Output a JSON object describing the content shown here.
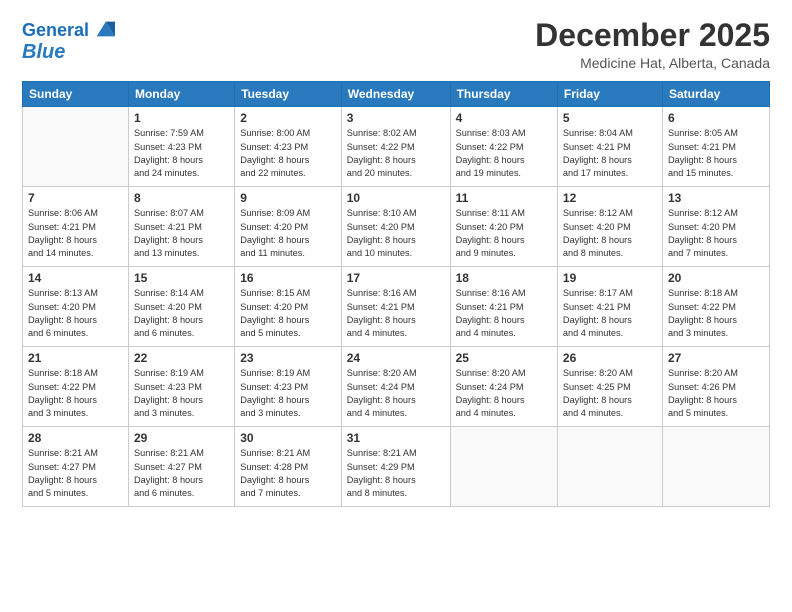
{
  "logo": {
    "line1": "General",
    "line2": "Blue"
  },
  "header": {
    "month": "December 2025",
    "location": "Medicine Hat, Alberta, Canada"
  },
  "weekdays": [
    "Sunday",
    "Monday",
    "Tuesday",
    "Wednesday",
    "Thursday",
    "Friday",
    "Saturday"
  ],
  "weeks": [
    [
      {
        "day": "",
        "info": ""
      },
      {
        "day": "1",
        "info": "Sunrise: 7:59 AM\nSunset: 4:23 PM\nDaylight: 8 hours\nand 24 minutes."
      },
      {
        "day": "2",
        "info": "Sunrise: 8:00 AM\nSunset: 4:23 PM\nDaylight: 8 hours\nand 22 minutes."
      },
      {
        "day": "3",
        "info": "Sunrise: 8:02 AM\nSunset: 4:22 PM\nDaylight: 8 hours\nand 20 minutes."
      },
      {
        "day": "4",
        "info": "Sunrise: 8:03 AM\nSunset: 4:22 PM\nDaylight: 8 hours\nand 19 minutes."
      },
      {
        "day": "5",
        "info": "Sunrise: 8:04 AM\nSunset: 4:21 PM\nDaylight: 8 hours\nand 17 minutes."
      },
      {
        "day": "6",
        "info": "Sunrise: 8:05 AM\nSunset: 4:21 PM\nDaylight: 8 hours\nand 15 minutes."
      }
    ],
    [
      {
        "day": "7",
        "info": "Sunrise: 8:06 AM\nSunset: 4:21 PM\nDaylight: 8 hours\nand 14 minutes."
      },
      {
        "day": "8",
        "info": "Sunrise: 8:07 AM\nSunset: 4:21 PM\nDaylight: 8 hours\nand 13 minutes."
      },
      {
        "day": "9",
        "info": "Sunrise: 8:09 AM\nSunset: 4:20 PM\nDaylight: 8 hours\nand 11 minutes."
      },
      {
        "day": "10",
        "info": "Sunrise: 8:10 AM\nSunset: 4:20 PM\nDaylight: 8 hours\nand 10 minutes."
      },
      {
        "day": "11",
        "info": "Sunrise: 8:11 AM\nSunset: 4:20 PM\nDaylight: 8 hours\nand 9 minutes."
      },
      {
        "day": "12",
        "info": "Sunrise: 8:12 AM\nSunset: 4:20 PM\nDaylight: 8 hours\nand 8 minutes."
      },
      {
        "day": "13",
        "info": "Sunrise: 8:12 AM\nSunset: 4:20 PM\nDaylight: 8 hours\nand 7 minutes."
      }
    ],
    [
      {
        "day": "14",
        "info": "Sunrise: 8:13 AM\nSunset: 4:20 PM\nDaylight: 8 hours\nand 6 minutes."
      },
      {
        "day": "15",
        "info": "Sunrise: 8:14 AM\nSunset: 4:20 PM\nDaylight: 8 hours\nand 6 minutes."
      },
      {
        "day": "16",
        "info": "Sunrise: 8:15 AM\nSunset: 4:20 PM\nDaylight: 8 hours\nand 5 minutes."
      },
      {
        "day": "17",
        "info": "Sunrise: 8:16 AM\nSunset: 4:21 PM\nDaylight: 8 hours\nand 4 minutes."
      },
      {
        "day": "18",
        "info": "Sunrise: 8:16 AM\nSunset: 4:21 PM\nDaylight: 8 hours\nand 4 minutes."
      },
      {
        "day": "19",
        "info": "Sunrise: 8:17 AM\nSunset: 4:21 PM\nDaylight: 8 hours\nand 4 minutes."
      },
      {
        "day": "20",
        "info": "Sunrise: 8:18 AM\nSunset: 4:22 PM\nDaylight: 8 hours\nand 3 minutes."
      }
    ],
    [
      {
        "day": "21",
        "info": "Sunrise: 8:18 AM\nSunset: 4:22 PM\nDaylight: 8 hours\nand 3 minutes."
      },
      {
        "day": "22",
        "info": "Sunrise: 8:19 AM\nSunset: 4:23 PM\nDaylight: 8 hours\nand 3 minutes."
      },
      {
        "day": "23",
        "info": "Sunrise: 8:19 AM\nSunset: 4:23 PM\nDaylight: 8 hours\nand 3 minutes."
      },
      {
        "day": "24",
        "info": "Sunrise: 8:20 AM\nSunset: 4:24 PM\nDaylight: 8 hours\nand 4 minutes."
      },
      {
        "day": "25",
        "info": "Sunrise: 8:20 AM\nSunset: 4:24 PM\nDaylight: 8 hours\nand 4 minutes."
      },
      {
        "day": "26",
        "info": "Sunrise: 8:20 AM\nSunset: 4:25 PM\nDaylight: 8 hours\nand 4 minutes."
      },
      {
        "day": "27",
        "info": "Sunrise: 8:20 AM\nSunset: 4:26 PM\nDaylight: 8 hours\nand 5 minutes."
      }
    ],
    [
      {
        "day": "28",
        "info": "Sunrise: 8:21 AM\nSunset: 4:27 PM\nDaylight: 8 hours\nand 5 minutes."
      },
      {
        "day": "29",
        "info": "Sunrise: 8:21 AM\nSunset: 4:27 PM\nDaylight: 8 hours\nand 6 minutes."
      },
      {
        "day": "30",
        "info": "Sunrise: 8:21 AM\nSunset: 4:28 PM\nDaylight: 8 hours\nand 7 minutes."
      },
      {
        "day": "31",
        "info": "Sunrise: 8:21 AM\nSunset: 4:29 PM\nDaylight: 8 hours\nand 8 minutes."
      },
      {
        "day": "",
        "info": ""
      },
      {
        "day": "",
        "info": ""
      },
      {
        "day": "",
        "info": ""
      }
    ]
  ]
}
